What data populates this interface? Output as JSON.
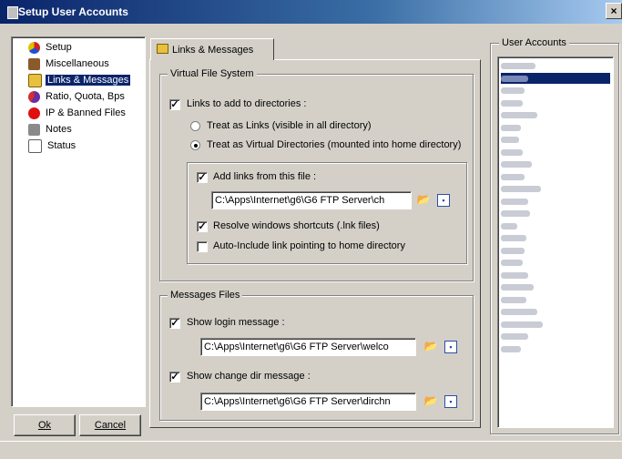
{
  "window": {
    "title": "Setup User Accounts",
    "close_glyph": "×"
  },
  "tree": {
    "items": [
      {
        "label": "Setup",
        "icon": "shapes-icon",
        "color": "#d02020",
        "selected": false
      },
      {
        "label": "Miscellaneous",
        "icon": "box-icon",
        "color": "#8b5a2b",
        "selected": false
      },
      {
        "label": "Links & Messages",
        "icon": "folder-icon",
        "color": "#e0b000",
        "selected": true
      },
      {
        "label": "Ratio, Quota, Bps",
        "icon": "pie-chart-icon",
        "color": "#6a2ca0",
        "selected": false
      },
      {
        "label": "IP & Banned Files",
        "icon": "ban-icon",
        "color": "#e01010",
        "selected": false
      },
      {
        "label": "Notes",
        "icon": "notes-icon",
        "color": "#606060",
        "selected": false
      },
      {
        "label": "Status",
        "icon": "document-icon",
        "color": "#ffffff",
        "selected": false
      }
    ]
  },
  "buttons": {
    "ok": "Ok",
    "cancel": "Cancel"
  },
  "tab": {
    "label": "Links & Messages"
  },
  "vfs": {
    "legend": "Virtual File System",
    "links_to_add": {
      "label": "Links to add to directories :",
      "checked": true
    },
    "radio_links": {
      "label": "Treat as Links (visible in all directory)",
      "selected": false
    },
    "radio_virtual": {
      "label": "Treat as Virtual Directories (mounted into home directory)",
      "selected": true
    },
    "add_from_file": {
      "label": "Add links from this file :",
      "checked": true
    },
    "file_path": "C:\\Apps\\Internet\\g6\\G6 FTP Server\\ch",
    "resolve_shortcuts": {
      "label": "Resolve windows shortcuts (.lnk files)",
      "checked": true
    },
    "auto_include": {
      "label": "Auto-Include link pointing to home directory",
      "checked": false
    }
  },
  "messages": {
    "legend": "Messages Files",
    "show_login": {
      "label": "Show login message :",
      "checked": true
    },
    "login_path": "C:\\Apps\\Internet\\g6\\G6 FTP Server\\welco",
    "show_change_dir": {
      "label": "Show change dir message :",
      "checked": true
    },
    "change_dir_path": "C:\\Apps\\Internet\\g6\\G6 FTP Server\\dirchn"
  },
  "user_accounts": {
    "legend": "User Accounts",
    "entries_count_visible": 24,
    "selected_index": 1
  },
  "colors": {
    "accent": "#0a246a",
    "face": "#d4d0c8"
  }
}
